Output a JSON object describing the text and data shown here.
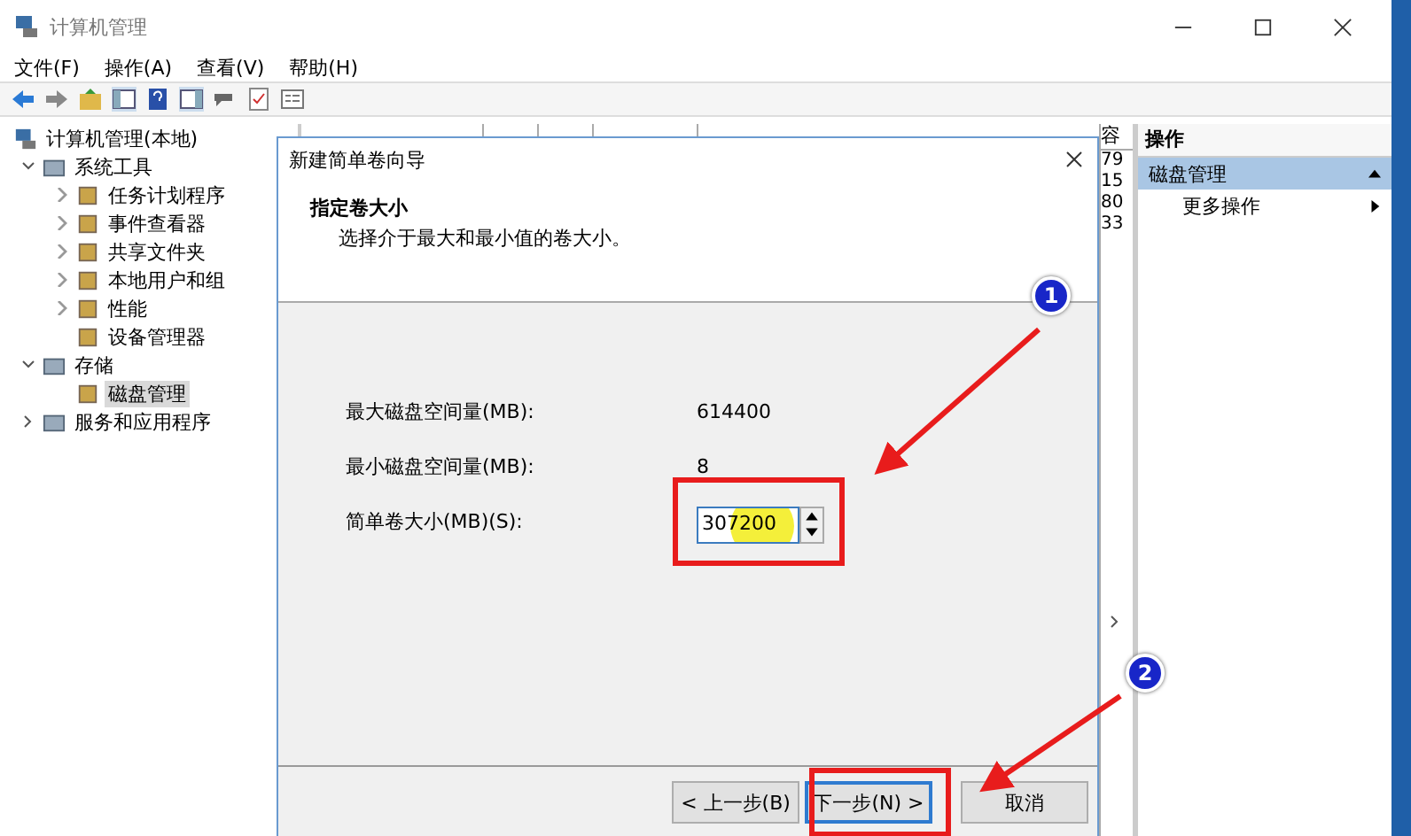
{
  "window": {
    "title": "计算机管理",
    "menu": [
      "文件(F)",
      "操作(A)",
      "查看(V)",
      "帮助(H)"
    ]
  },
  "tree": {
    "label": "计算机管理(本地)",
    "selected": false,
    "children": [
      {
        "label": "系统工具",
        "kind": "branch",
        "expanded": true,
        "selected": false,
        "children": [
          {
            "label": "任务计划程序",
            "kind": "branch",
            "expanded": false,
            "selected": false
          },
          {
            "label": "事件查看器",
            "kind": "branch",
            "expanded": false,
            "selected": false
          },
          {
            "label": "共享文件夹",
            "kind": "branch",
            "expanded": false,
            "selected": false
          },
          {
            "label": "本地用户和组",
            "kind": "branch",
            "expanded": false,
            "selected": false
          },
          {
            "label": "性能",
            "kind": "branch",
            "expanded": false,
            "selected": false
          },
          {
            "label": "设备管理器",
            "kind": "leaf",
            "selected": false
          }
        ]
      },
      {
        "label": "存储",
        "kind": "branch",
        "expanded": true,
        "selected": false,
        "children": [
          {
            "label": "磁盘管理",
            "kind": "leaf",
            "selected": true
          }
        ]
      },
      {
        "label": "服务和应用程序",
        "kind": "branch",
        "expanded": false,
        "selected": false
      }
    ]
  },
  "list": {
    "capacity_column": {
      "header": "容",
      "values": [
        "79",
        "15",
        "80",
        "33"
      ]
    }
  },
  "actions": {
    "title": "操作",
    "section": {
      "label": "磁盘管理",
      "expanded": true
    },
    "items": [
      "更多操作"
    ]
  },
  "dialog": {
    "title": "新建简单卷向导",
    "heading": "指定卷大小",
    "subtitle": "选择介于最大和最小值的卷大小。",
    "rows": [
      {
        "label": "最大磁盘空间量(MB):",
        "value": "614400"
      },
      {
        "label": "最小磁盘空间量(MB):",
        "value": "8"
      }
    ],
    "size_field": {
      "label": "简单卷大小(MB)(S):",
      "value": "307200"
    },
    "buttons": [
      {
        "label": "< 上一步(B)",
        "kind": "normal"
      },
      {
        "label": "下一步(N) >",
        "kind": "default"
      },
      {
        "label": "取消",
        "kind": "cancel"
      }
    ]
  },
  "annotations": [
    {
      "number": "1"
    },
    {
      "number": "2"
    }
  ]
}
